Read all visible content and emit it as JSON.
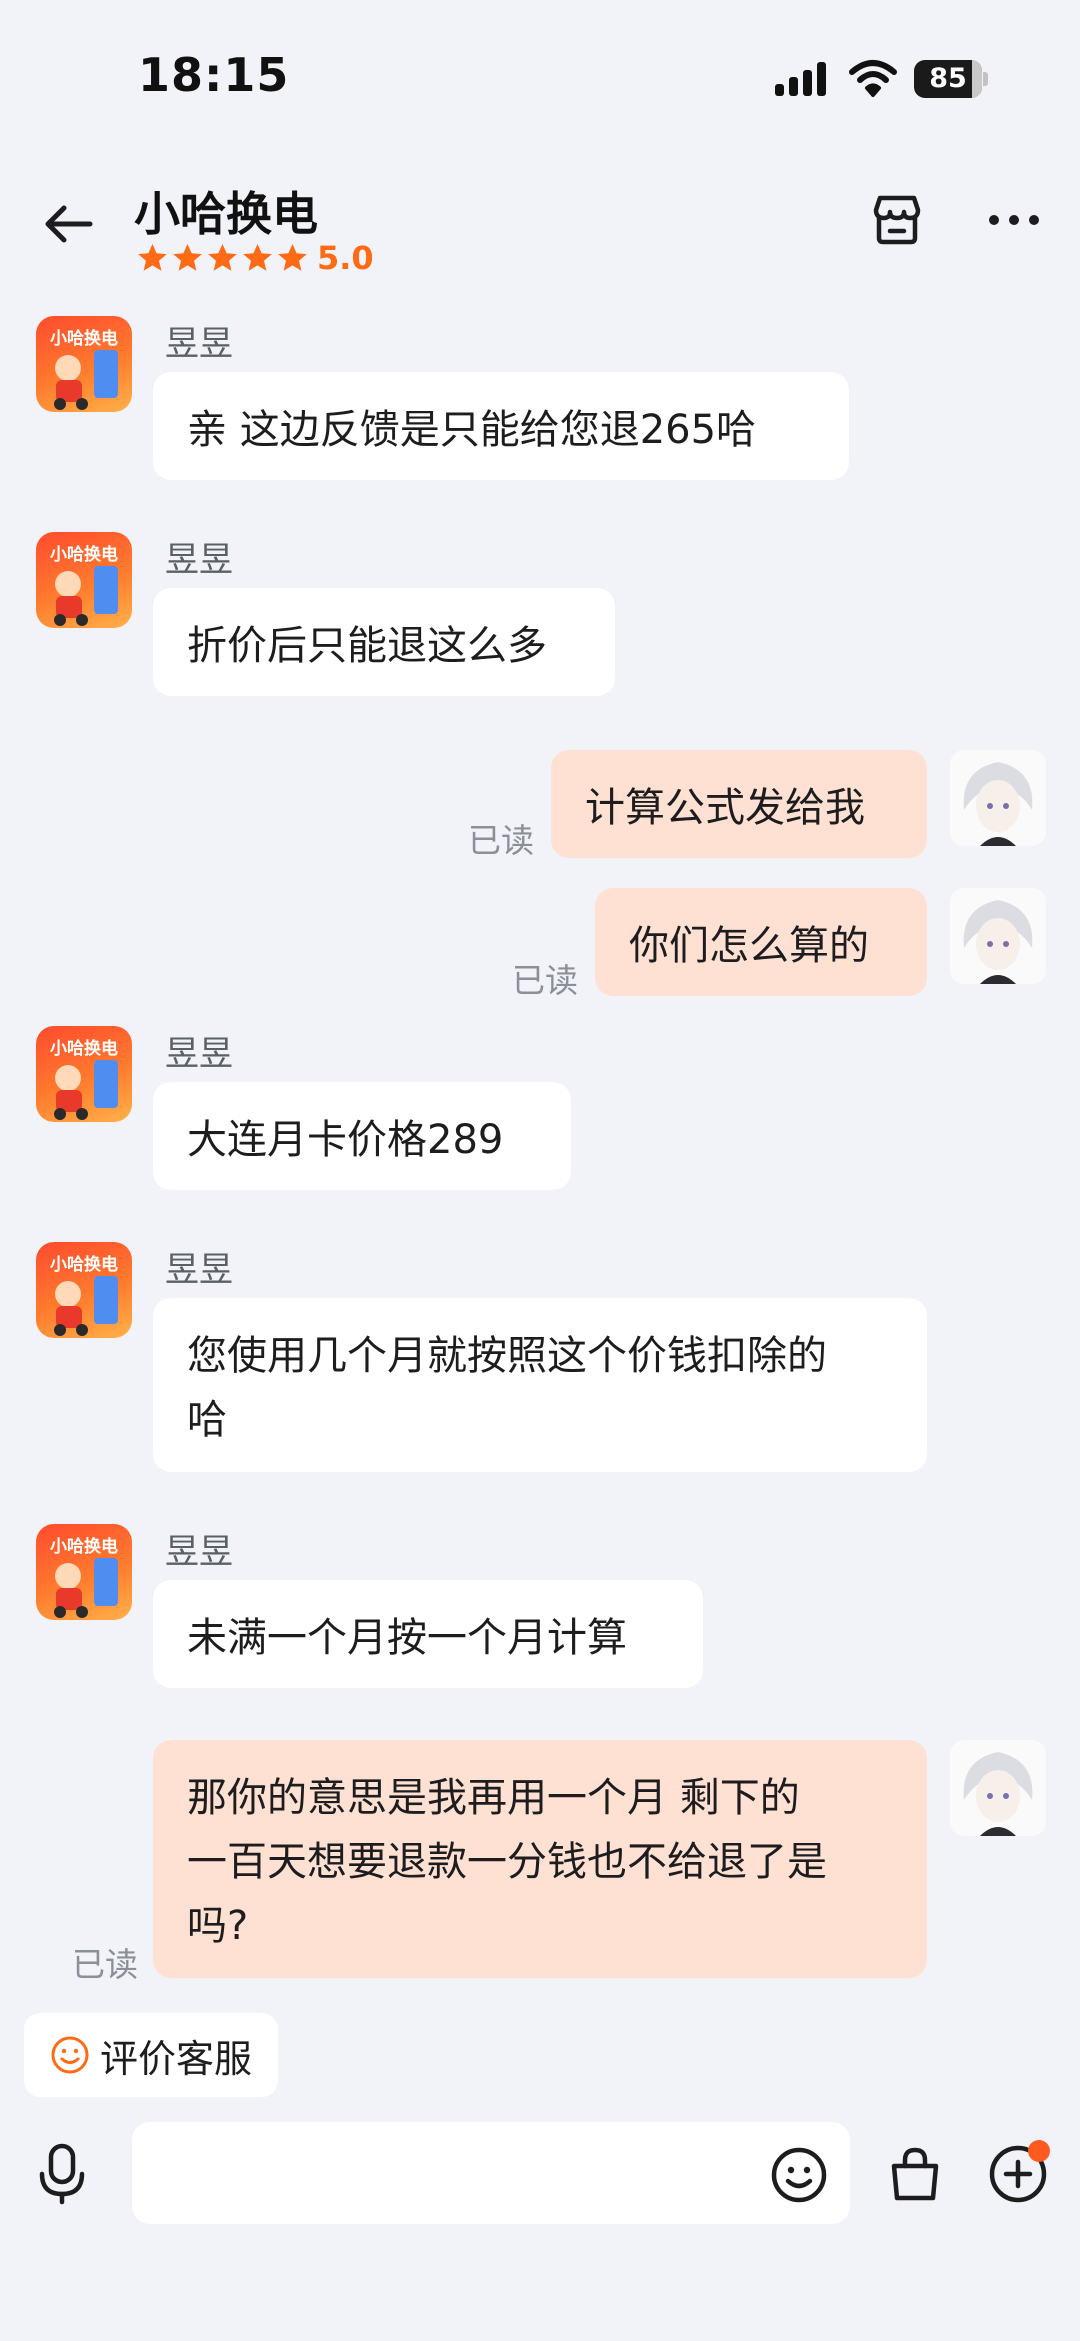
{
  "status_bar": {
    "time": "18:15",
    "battery": "85",
    "battery_level": 0.85
  },
  "header": {
    "title": "小哈换电",
    "rating": "5.0",
    "star_count": 5
  },
  "brand": {
    "logo_text": "小哈换电",
    "accent": "#ff6a14"
  },
  "messages": [
    {
      "sender": "昱昱",
      "text": "亲 这边反馈是只能给您退265哈"
    },
    {
      "sender": "昱昱",
      "text": "折价后只能退这么多"
    },
    {
      "text": "计算公式发给我",
      "status": "已读"
    },
    {
      "text": "你们怎么算的",
      "status": "已读"
    },
    {
      "sender": "昱昱",
      "text": "大连月卡价格289"
    },
    {
      "sender": "昱昱",
      "lines": [
        "您使用几个月就按照这个价钱扣除的",
        "哈"
      ]
    },
    {
      "sender": "昱昱",
      "text": "未满一个月按一个月计算"
    },
    {
      "lines": [
        "那你的意思是我再用一个月  剩下的",
        "一百天想要退款一分钱也不给退了是",
        "吗?"
      ],
      "status": "已读"
    }
  ],
  "rate_button": {
    "label": "评价客服"
  },
  "colors": {
    "background": "#f1f3f8",
    "outgoing_bubble": "#ffe1d3",
    "incoming_bubble": "#ffffff",
    "badge_dot": "#ff5a1f"
  }
}
